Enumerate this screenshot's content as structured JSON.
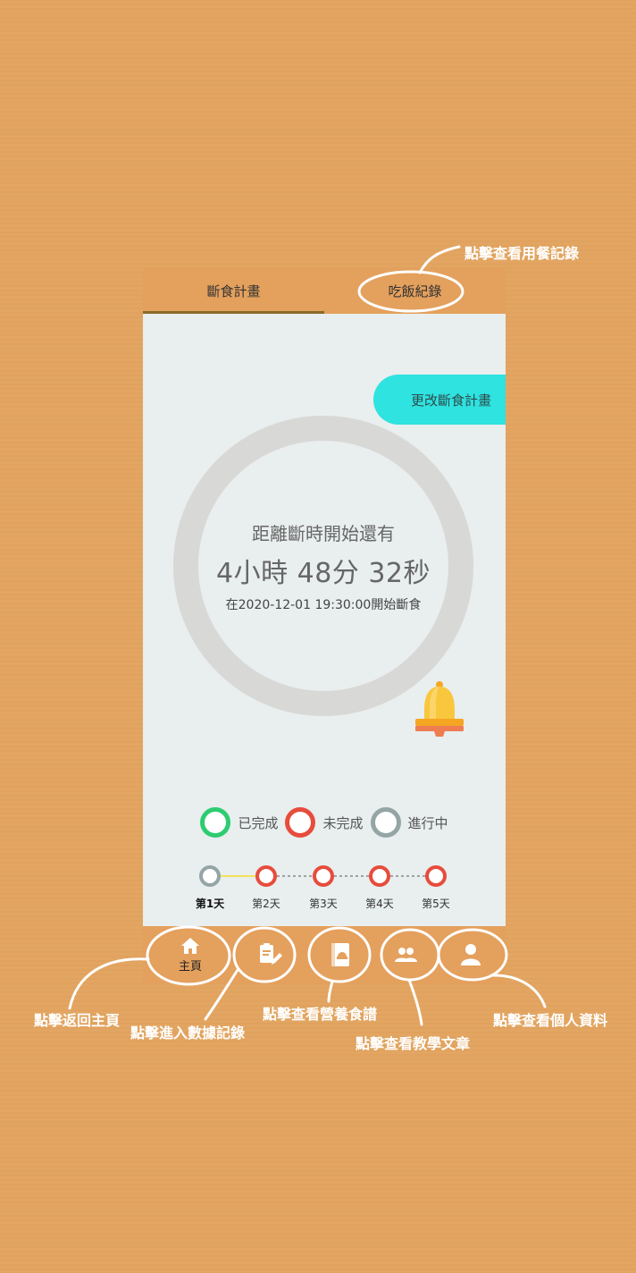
{
  "tabs": [
    {
      "label": "斷食計畫",
      "active": true
    },
    {
      "label": "吃飯紀錄",
      "active": false
    }
  ],
  "change_plan_button": "更改斷食計畫",
  "timer": {
    "label": "距離斷時開始還有",
    "countdown": "4小時 48分 32秒",
    "start_info": "在2020-12-01 19:30:00開始斷食"
  },
  "legend": [
    {
      "label": "已完成",
      "color": "#2ecc71"
    },
    {
      "label": "未完成",
      "color": "#e74c3c"
    },
    {
      "label": "進行中",
      "color": "#95a5a6"
    }
  ],
  "days": [
    {
      "label": "第1天",
      "status": "in-progress"
    },
    {
      "label": "第2天",
      "status": "incomplete"
    },
    {
      "label": "第3天",
      "status": "incomplete"
    },
    {
      "label": "第4天",
      "status": "incomplete"
    },
    {
      "label": "第5天",
      "status": "incomplete"
    }
  ],
  "nav": {
    "home": "主頁",
    "icons": [
      "home-icon",
      "edit-note-icon",
      "recipe-book-icon",
      "group-icon",
      "person-icon"
    ]
  },
  "annotations": {
    "meal_records": "點擊查看用餐記錄",
    "home": "點擊返回主頁",
    "data_record": "點擊進入數據記錄",
    "recipes": "點擊查看營養食譜",
    "articles": "點擊查看教學文章",
    "profile": "點擊查看個人資料"
  },
  "colors": {
    "background": "#e3a662",
    "bar": "#e4a05d",
    "accent": "#2ee3e0",
    "ring": "#d8d8d6"
  }
}
